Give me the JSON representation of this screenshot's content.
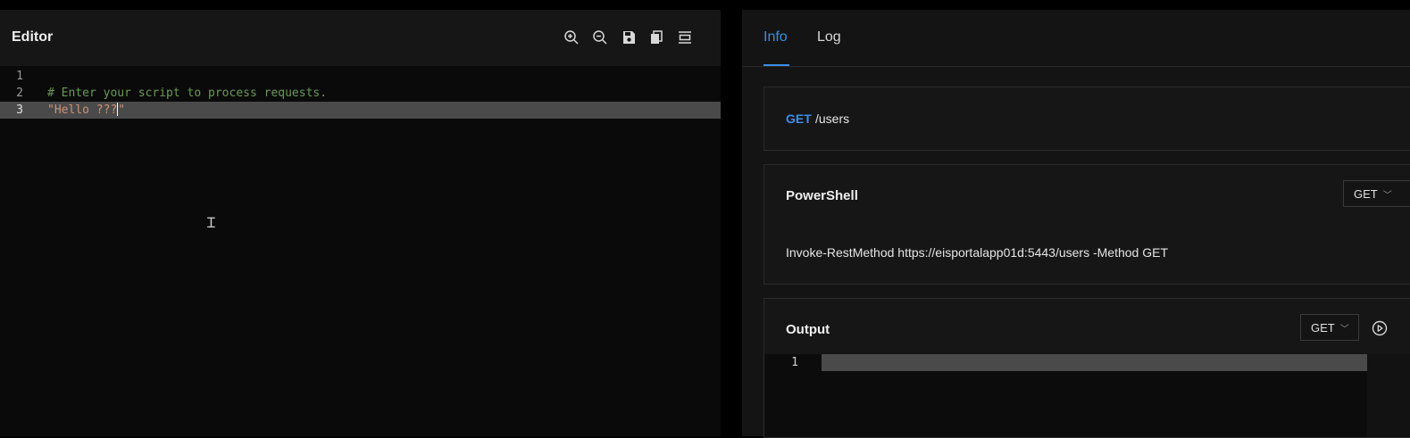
{
  "editor": {
    "title": "Editor",
    "toolbar": [
      {
        "name": "zoom-in-icon"
      },
      {
        "name": "zoom-out-icon"
      },
      {
        "name": "save-icon"
      },
      {
        "name": "copy-icon"
      },
      {
        "name": "format-icon"
      }
    ],
    "lines": [
      {
        "number": "1",
        "text": ""
      },
      {
        "number": "2",
        "text": "# Enter your script to process requests."
      },
      {
        "number": "3",
        "text_before_caret": "\"Hello ???",
        "text_after_caret": "\""
      }
    ]
  },
  "tabs": {
    "info": "Info",
    "log": "Log",
    "active": "Info"
  },
  "request": {
    "method": "GET",
    "path": "/users"
  },
  "powershell": {
    "title": "PowerShell",
    "selected_method": "GET",
    "command": "Invoke-RestMethod https://eisportalapp01d:5443/users -Method GET"
  },
  "output": {
    "title": "Output",
    "selected_method": "GET",
    "line_number": "1"
  },
  "colors": {
    "accent": "#3b8eea",
    "comment": "#6a9955",
    "string": "#ce9178"
  }
}
